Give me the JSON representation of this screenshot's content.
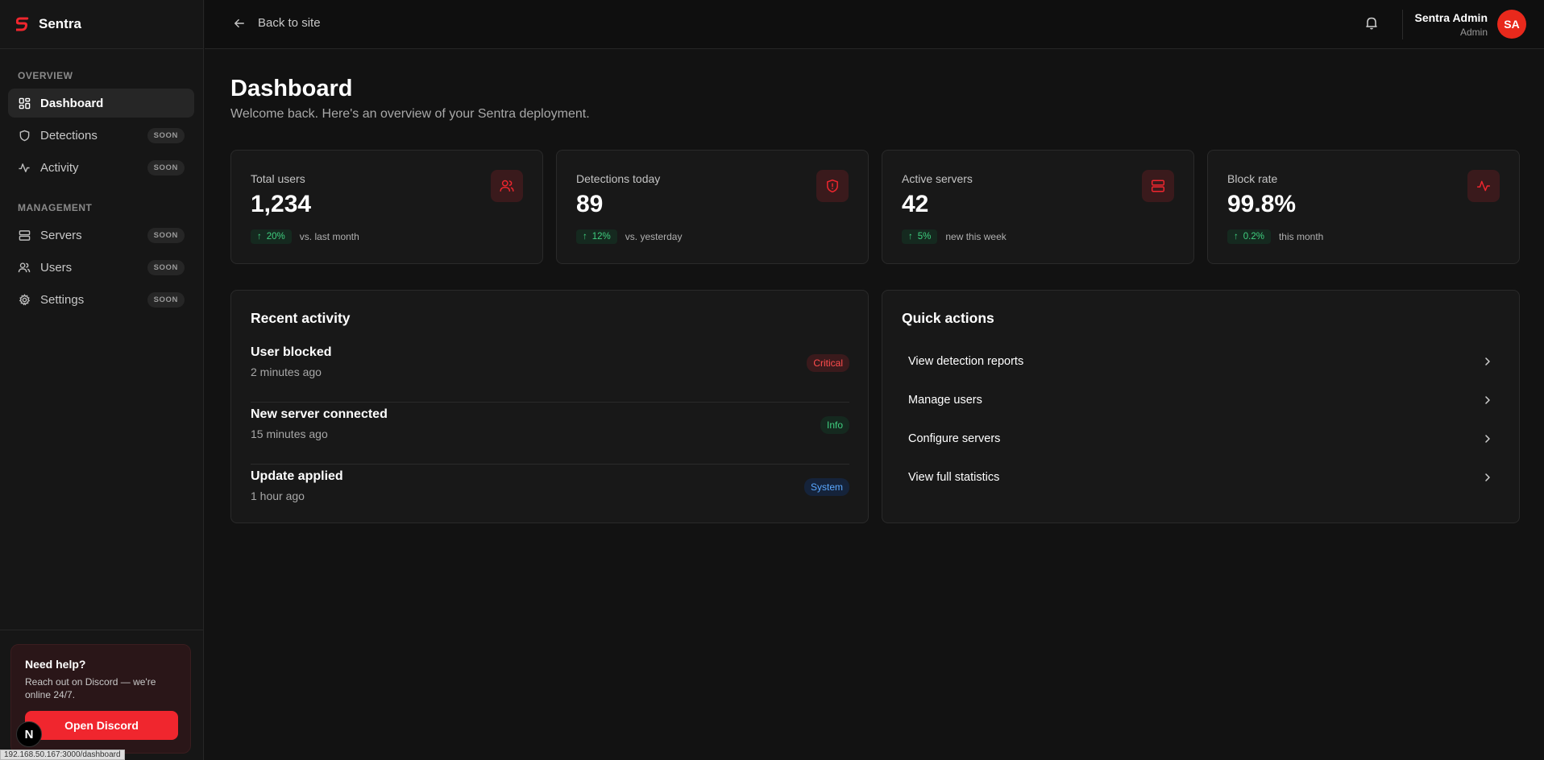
{
  "brand": {
    "name": "Sentra",
    "accent": "#f0262e"
  },
  "sidebar": {
    "sections": [
      {
        "title": "OVERVIEW"
      },
      {
        "title": "MANAGEMENT"
      }
    ],
    "items": [
      {
        "label": "Dashboard",
        "icon": "dashboard-icon",
        "active": true,
        "badge": ""
      },
      {
        "label": "Detections",
        "icon": "shield-icon",
        "badge": "SOON"
      },
      {
        "label": "Activity",
        "icon": "activity-icon",
        "badge": "SOON"
      },
      {
        "label": "Servers",
        "icon": "server-icon",
        "badge": "SOON"
      },
      {
        "label": "Users",
        "icon": "users-icon",
        "badge": "SOON"
      },
      {
        "label": "Settings",
        "icon": "gear-icon",
        "badge": "SOON"
      }
    ],
    "help": {
      "title": "Need help?",
      "text": "Reach out on Discord — we're online 24/7.",
      "button": "Open Discord"
    }
  },
  "topbar": {
    "back_label": "Back to site",
    "user_name": "Sentra Admin",
    "user_role": "Admin",
    "avatar_initials": "SA"
  },
  "page": {
    "title": "Dashboard",
    "subtitle": "Welcome back. Here's an overview of your Sentra deployment."
  },
  "stats": [
    {
      "label": "Total users",
      "value": "1,234",
      "change": "20%",
      "note": "vs. last month",
      "icon": "users-icon"
    },
    {
      "label": "Detections today",
      "value": "89",
      "change": "12%",
      "note": "vs. yesterday",
      "icon": "shield-alert-icon"
    },
    {
      "label": "Active servers",
      "value": "42",
      "change": "5%",
      "note": "new this week",
      "icon": "server-icon"
    },
    {
      "label": "Block rate",
      "value": "99.8%",
      "change": "0.2%",
      "note": "this month",
      "icon": "activity-icon"
    }
  ],
  "recent_activity": {
    "title": "Recent activity",
    "items": [
      {
        "title": "User blocked",
        "time": "2 minutes ago",
        "badge": "Critical",
        "badge_color": "#ff4d4d",
        "badge_bg": "#3a1a1c"
      },
      {
        "title": "New server connected",
        "time": "15 minutes ago",
        "badge": "Info",
        "badge_color": "#3fcf7f",
        "badge_bg": "#15291f"
      },
      {
        "title": "Update applied",
        "time": "1 hour ago",
        "badge": "System",
        "badge_color": "#5aa8ff",
        "badge_bg": "#15233a"
      }
    ]
  },
  "quick_actions": {
    "title": "Quick actions",
    "items": [
      {
        "label": "View detection reports"
      },
      {
        "label": "Manage users"
      },
      {
        "label": "Configure servers"
      },
      {
        "label": "View full statistics"
      }
    ]
  },
  "dev": {
    "badge": "N",
    "status_url": "192.168.50.167:3000/dashboard"
  }
}
